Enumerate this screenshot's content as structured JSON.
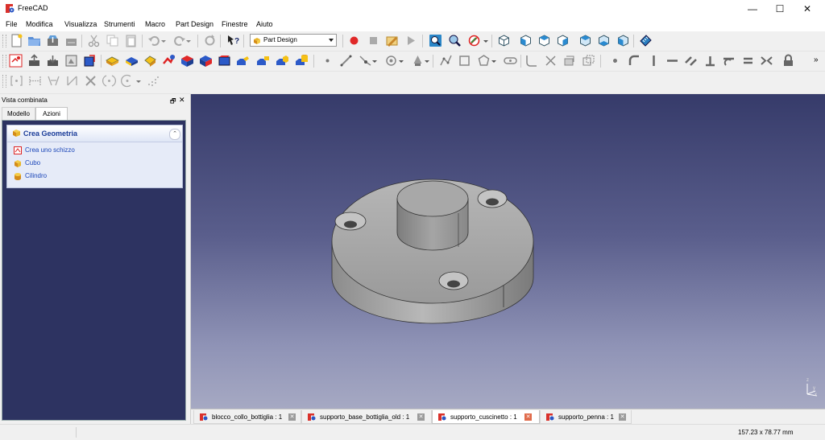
{
  "window": {
    "title": "FreeCAD",
    "controls": {
      "minimize": "—",
      "maximize": "☐",
      "close": "✕"
    }
  },
  "menu": [
    "File",
    "Modifica",
    "Visualizza",
    "Strumenti",
    "Macro",
    "Part Design",
    "Finestre",
    "Aiuto"
  ],
  "toolbar": {
    "workbench_selector": "Part Design",
    "overflow": "»"
  },
  "combo_view": {
    "title": "Vista combinata",
    "float_label": "🗗",
    "close_label": "✕",
    "tabs": [
      "Modello",
      "Azioni"
    ],
    "active_tab": "Azioni",
    "taskbox": {
      "title": "Crea Geometria",
      "collapse_label": "⌃",
      "items": [
        "Crea uno schizzo",
        "Cubo",
        "Cilindro"
      ]
    }
  },
  "doc_tabs": [
    {
      "label": "blocco_collo_bottiglia : 1",
      "active": false
    },
    {
      "label": "supporto_base_bottiglia_old : 1",
      "active": false
    },
    {
      "label": "supporto_cuscinetto : 1",
      "active": true
    },
    {
      "label": "supporto_penna : 1",
      "active": false
    }
  ],
  "status": {
    "dimensions": "157.23 x 78.77 mm"
  },
  "colors": {
    "view_top": "#363b6a",
    "view_bottom": "#a6a9c3",
    "part_body": "#a9a9a9",
    "accent_link": "#1a45b8",
    "active_tab_close": "#e06b4b"
  },
  "axis_labels": {
    "x": "x",
    "y": "y",
    "z": "z"
  }
}
